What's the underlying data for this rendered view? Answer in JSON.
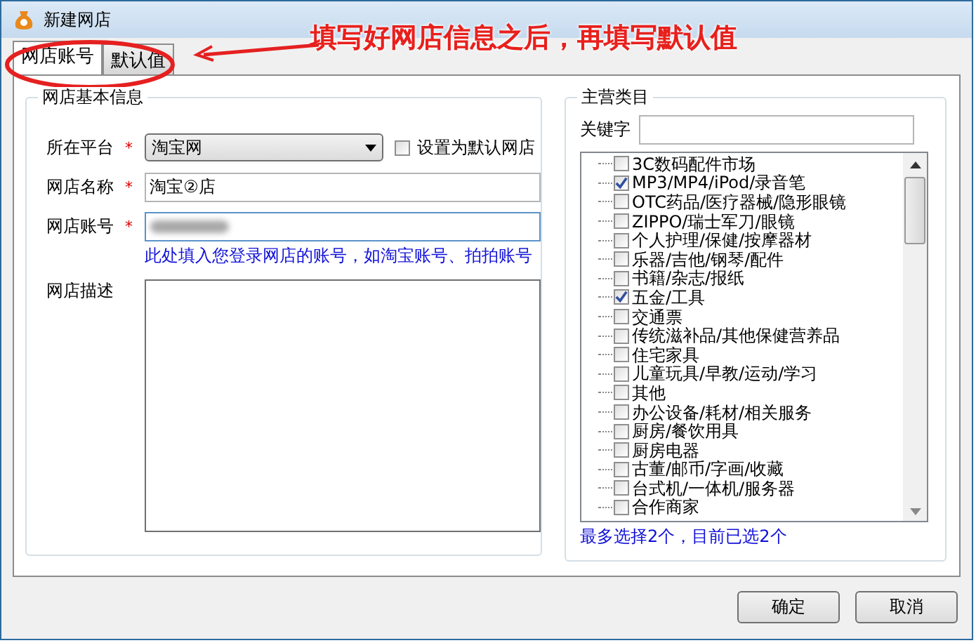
{
  "window": {
    "title": "新建网店"
  },
  "annotation": {
    "text": "填写好网店信息之后，再填写默认值"
  },
  "tabs": [
    {
      "label": "网店账号",
      "selected": true
    },
    {
      "label": "默认值",
      "selected": false
    }
  ],
  "basic_info": {
    "title": "网店基本信息",
    "platform": {
      "label": "所在平台",
      "required_mark": "*",
      "value": "淘宝网",
      "default_checkbox": {
        "label": "设置为默认网店",
        "checked": false
      }
    },
    "shop_name": {
      "label": "网店名称",
      "required_mark": "*",
      "value": "淘宝②店"
    },
    "shop_account": {
      "label": "网店账号",
      "required_mark": "*",
      "blurred": true,
      "hint": "此处填入您登录网店的账号，如淘宝账号、拍拍账号"
    },
    "description": {
      "label": "网店描述"
    }
  },
  "categories": {
    "title": "主营类目",
    "keyword_label": "关键字",
    "items": [
      {
        "label": "3C数码配件市场",
        "checked": false
      },
      {
        "label": "MP3/MP4/iPod/录音笔",
        "checked": true
      },
      {
        "label": "OTC药品/医疗器械/隐形眼镜",
        "checked": false
      },
      {
        "label": "ZIPPO/瑞士军刀/眼镜",
        "checked": false
      },
      {
        "label": "个人护理/保健/按摩器材",
        "checked": false
      },
      {
        "label": "乐器/吉他/钢琴/配件",
        "checked": false
      },
      {
        "label": "书籍/杂志/报纸",
        "checked": false
      },
      {
        "label": "五金/工具",
        "checked": true
      },
      {
        "label": "交通票",
        "checked": false
      },
      {
        "label": "传统滋补品/其他保健营养品",
        "checked": false
      },
      {
        "label": "住宅家具",
        "checked": false
      },
      {
        "label": "儿童玩具/早教/运动/学习",
        "checked": false
      },
      {
        "label": "其他",
        "checked": false
      },
      {
        "label": "办公设备/耗材/相关服务",
        "checked": false
      },
      {
        "label": "厨房/餐饮用具",
        "checked": false
      },
      {
        "label": "厨房电器",
        "checked": false
      },
      {
        "label": "古董/邮币/字画/收藏",
        "checked": false
      },
      {
        "label": "台式机/一体机/服务器",
        "checked": false
      },
      {
        "label": "合作商家",
        "checked": false
      }
    ],
    "status": "最多选择2个，目前已选2个"
  },
  "buttons": [
    "确定",
    "取消"
  ]
}
